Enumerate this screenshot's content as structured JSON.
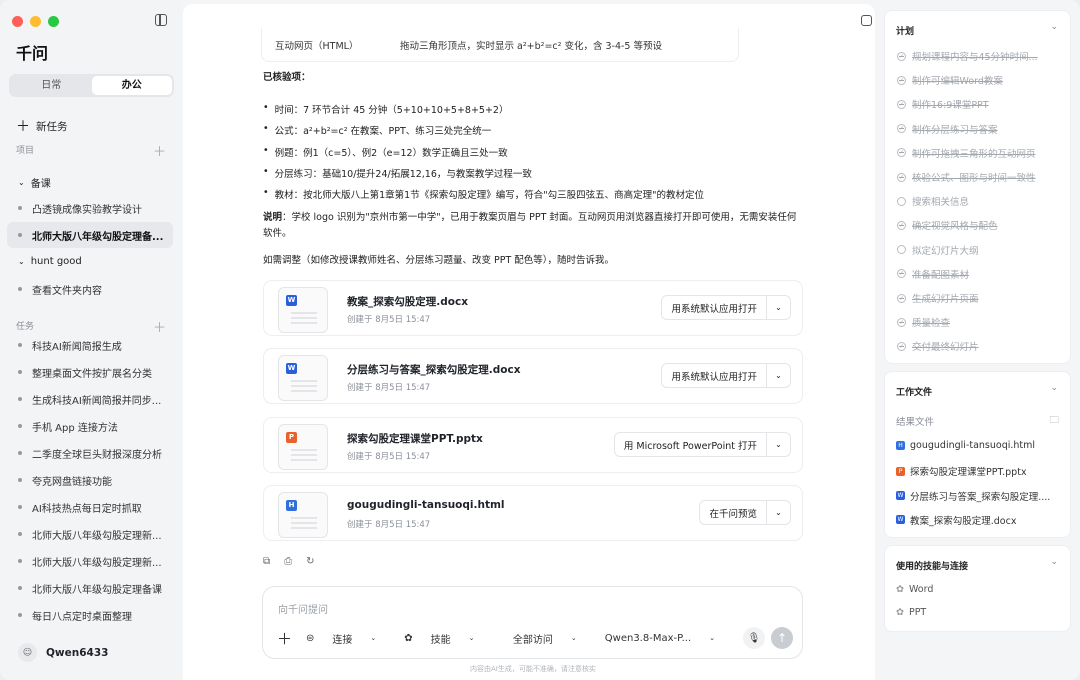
{
  "app": {
    "title": "千问"
  },
  "colors": {
    "word": "#2b5fd9",
    "ppt": "#e8622c",
    "html": "#2f6fe0"
  },
  "tabs": {
    "daily": "日常",
    "office": "办公"
  },
  "sidebar": {
    "new_task": "新任务",
    "projects_label": "项目",
    "groups": [
      {
        "label": "备课"
      },
      {
        "label": "hunt good"
      }
    ],
    "project_items": [
      "凸透镜成像实验教学设计",
      "北师大版八年级勾股定理备...",
      "查看文件夹内容"
    ],
    "tasks_label": "任务",
    "tasks": [
      "科技AI新闻简报生成",
      "整理桌面文件按扩展名分类",
      "生成科技AI新闻简报并同步...",
      "手机 App 连接方法",
      "二季度全球巨头财报深度分析",
      "夸克网盘链接功能",
      "AI科技热点每日定时抓取",
      "北师大版八年级勾股定理新...",
      "北师大版八年级勾股定理新...",
      "北师大版八年级勾股定理备课",
      "每日八点定时桌面整理"
    ],
    "user": "Qwen6433"
  },
  "main": {
    "table_row": {
      "col1": "互动网页（HTML）",
      "col2": "拖动三角形顶点，实时显示 a²+b²=c² 变化，含 3-4-5 等预设"
    },
    "verified_title": "已核验项：",
    "bullets": [
      "时间：7 环节合计 45 分钟（5+10+10+5+8+5+2）",
      "公式：a²+b²=c² 在教案、PPT、练习三处完全统一",
      "例题：例1（c=5）、例2（e=12）数学正确且三处一致",
      "分层练习：基础10/提升24/拓展12,16，与教案教学过程一致",
      "教材：按北师大版八上第1章第1节《探索勾股定理》编写，符合\"勾三股四弦五、商高定理\"的教材定位"
    ],
    "note_label": "说明",
    "note_text": "：学校 logo 识别为\"京州市第一中学\"，已用于教案页眉与 PPT 封面。互动网页用浏览器直接打开即可使用，无需安装任何软件。",
    "followup": "如需调整（如修改授课教师姓名、分层练习题量、改变 PPT 配色等），随时告诉我。",
    "files": [
      {
        "name": "教案_探索勾股定理.docx",
        "time": "创建于 8月5日 15:47",
        "open": "用系统默认应用打开",
        "icon": "W",
        "type": "word"
      },
      {
        "name": "分层练习与答案_探索勾股定理.docx",
        "time": "创建于 8月5日 15:47",
        "open": "用系统默认应用打开",
        "icon": "W",
        "type": "word"
      },
      {
        "name": "探索勾股定理课堂PPT.pptx",
        "time": "创建于 8月5日 15:47",
        "open": "用 Microsoft PowerPoint 打开",
        "icon": "P",
        "type": "ppt"
      },
      {
        "name": "gougudingli-tansuoqi.html",
        "time": "创建于 8月5日 15:47",
        "open": "在千问预览",
        "icon": "H",
        "type": "html"
      }
    ],
    "input_placeholder": "向千问提问",
    "connect": "连接",
    "skills": "技能",
    "access": "全部访问",
    "model": "Qwen3.8-Max-P...",
    "footer": "内容由AI生成，可能不准确，请注意核实"
  },
  "right": {
    "plan_title": "计划",
    "plan": [
      {
        "label": "规划课程内容与45分钟时间...",
        "done": true
      },
      {
        "label": "制作可编辑Word教案",
        "done": true
      },
      {
        "label": "制作16:9课堂PPT",
        "done": true
      },
      {
        "label": "制作分层练习与答案",
        "done": true
      },
      {
        "label": "制作可拖拽三角形的互动网页",
        "done": true
      },
      {
        "label": "核验公式、图形与时间一致性",
        "done": true
      },
      {
        "label": "搜索相关信息",
        "done": false
      },
      {
        "label": "确定视觉风格与配色",
        "done": true
      },
      {
        "label": "拟定幻灯片大纲",
        "done": false
      },
      {
        "label": "准备配图素材",
        "done": true
      },
      {
        "label": "生成幻灯片页面",
        "done": true
      },
      {
        "label": "质量检查",
        "done": true
      },
      {
        "label": "交付最终幻灯片",
        "done": true
      }
    ],
    "files_title": "工作文件",
    "result_label": "结果文件",
    "result_files": [
      {
        "name": "gougudingli-tansuoqi.html",
        "icon": "H",
        "type": "html"
      },
      {
        "name": "探索勾股定理课堂PPT.pptx",
        "icon": "P",
        "type": "ppt"
      },
      {
        "name": "分层练习与答案_探索勾股定理....",
        "icon": "W",
        "type": "word"
      },
      {
        "name": "教案_探索勾股定理.docx",
        "icon": "W",
        "type": "word"
      }
    ],
    "skills_title": "使用的技能与连接",
    "skills": [
      "Word",
      "PPT"
    ]
  }
}
